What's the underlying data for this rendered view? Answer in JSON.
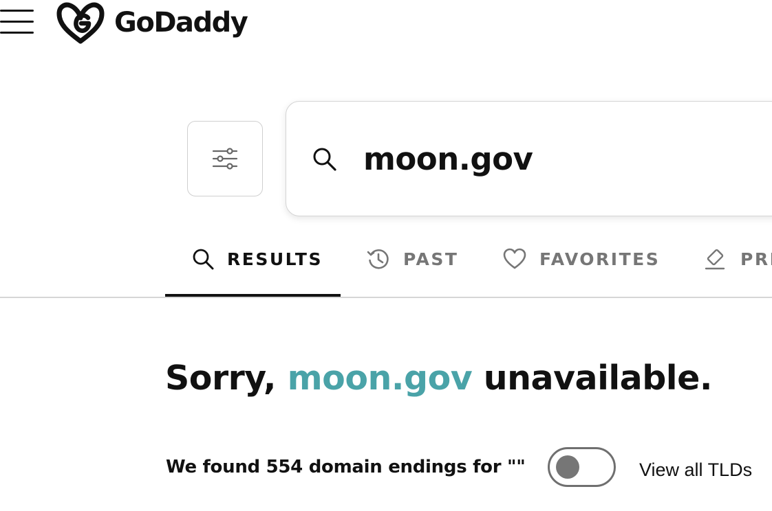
{
  "header": {
    "logo_text": "GoDaddy",
    "menu_icon": "hamburger-menu-icon"
  },
  "search": {
    "filter_icon": "sliders-icon",
    "icon": "search-icon",
    "value": "moon.gov"
  },
  "tabs": [
    {
      "label": "RESULTS",
      "icon": "search-icon",
      "active": true
    },
    {
      "label": "PAST",
      "icon": "history-icon",
      "active": false
    },
    {
      "label": "FAVORITES",
      "icon": "heart-icon",
      "active": false
    },
    {
      "label": "PRE",
      "icon": "gavel-icon",
      "active": false
    }
  ],
  "result": {
    "prefix": "Sorry,",
    "domain": "moon.gov",
    "suffix": "unavailable."
  },
  "endings": {
    "text": "We found 554 domain endings for \"\"",
    "toggle_on": false,
    "toggle_label": "View all TLDs"
  },
  "colors": {
    "domain_accent": "#4aa3a8",
    "text": "#111111",
    "muted": "#767676"
  }
}
